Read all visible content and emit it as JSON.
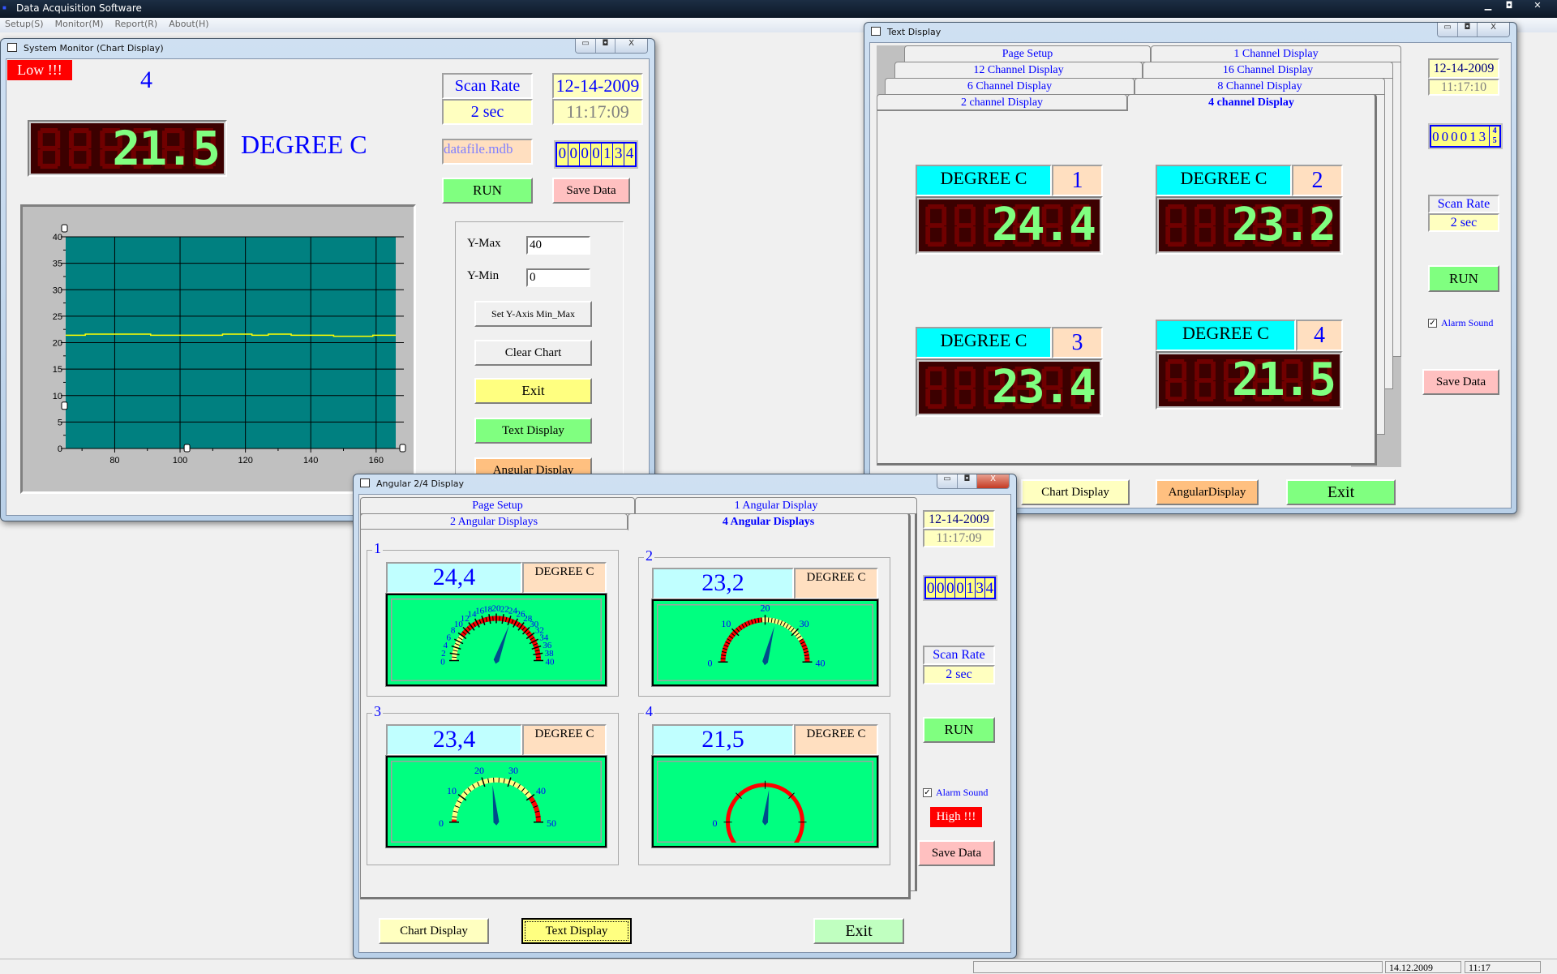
{
  "app": {
    "title": "Data Acquisition Software",
    "menu": [
      "Setup(S)",
      "Monitor(M)",
      "Report(R)",
      "About(H)"
    ]
  },
  "window_buttons": {
    "minimize": "▭",
    "maximize": "◘",
    "close": "X"
  },
  "chart_window": {
    "title": "System Monitor (Chart Display)",
    "alarm": "Low !!!",
    "channel": "4",
    "led_value": "21.5",
    "unit": "DEGREE C",
    "scan_rate_label": "Scan Rate",
    "scan_rate_value": "2 sec",
    "date": "12-14-2009",
    "time": "11:17:09",
    "file": "datafile.mdb",
    "counter": "0000134",
    "run": "RUN",
    "save": "Save Data",
    "ymax_label": "Y-Max",
    "ymax_value": "40",
    "ymin_label": "Y-Min",
    "ymin_value": "0",
    "set_axis": "Set Y-Axis Min_Max",
    "clear_chart": "Clear Chart",
    "exit": "Exit",
    "text_display": "Text Display",
    "angular_display": "Angular Display"
  },
  "chart_data": {
    "type": "line",
    "title": "",
    "xlabel": "",
    "ylabel": "",
    "xlim": [
      65,
      166
    ],
    "ylim": [
      0,
      40
    ],
    "xticks": [
      80,
      100,
      120,
      140,
      160
    ],
    "yticks": [
      0,
      5,
      10,
      15,
      20,
      25,
      30,
      35,
      40
    ],
    "grid": true,
    "background": "#008080",
    "series": [
      {
        "color": "#ffff00",
        "step": true,
        "x": [
          65,
          71,
          91,
          113,
          122,
          127,
          134,
          147,
          159,
          166
        ],
        "y": [
          21.4,
          21.6,
          21.4,
          21.6,
          21.4,
          21.6,
          21.4,
          21.2,
          21.4,
          21.4
        ]
      }
    ]
  },
  "text_window": {
    "title": "Text Display",
    "tabs": [
      [
        "Page Setup",
        "1 Channel Display"
      ],
      [
        "12 Channel Display",
        "16 Channel Display"
      ],
      [
        "6 Channel Display",
        "8 Channel Display"
      ],
      [
        "2 channel Display",
        "4 channel Display"
      ]
    ],
    "active_tab": "4 channel Display",
    "channels": [
      {
        "unit": "DEGREE C",
        "num": "1",
        "value": "24.4"
      },
      {
        "unit": "DEGREE C",
        "num": "2",
        "value": "23.2"
      },
      {
        "unit": "DEGREE C",
        "num": "3",
        "value": "23.4"
      },
      {
        "unit": "DEGREE C",
        "num": "4",
        "value": "21.5"
      }
    ],
    "date": "12-14-2009",
    "time": "11:17:10",
    "counter": "000013",
    "counter_rolling": [
      "4",
      "5"
    ],
    "scan_rate_label": "Scan Rate",
    "scan_rate_value": "2 sec",
    "run": "RUN",
    "alarm_sound": "Alarm Sound",
    "alarm_checked": true,
    "save": "Save Data",
    "chart_display": "Chart Display",
    "angular_display": "AngularDisplay",
    "exit": "Exit"
  },
  "angular_window": {
    "title": "Angular 2/4 Display",
    "tabs": [
      [
        "Page Setup",
        "1 Angular Display"
      ],
      [
        "2 Angular Displays",
        "4 Angular  Displays"
      ]
    ],
    "active_tab": "4 Angular  Displays",
    "gauges": [
      {
        "num": "1",
        "value": "24,4",
        "reading": 24.4,
        "unit": "DEGREE C",
        "max": 40,
        "labels": [
          0,
          2,
          4,
          6,
          8,
          10,
          12,
          14,
          16,
          18,
          20,
          22,
          24,
          26,
          28,
          30,
          32,
          34,
          36,
          38,
          40
        ],
        "zones": [
          {
            "from": 0,
            "to": 8,
            "color": "#ffff80"
          },
          {
            "from": 8,
            "to": 40,
            "color": "#ff0000"
          }
        ]
      },
      {
        "num": "2",
        "value": "23,2",
        "reading": 23.2,
        "unit": "DEGREE C",
        "max": 40,
        "labels": [
          0,
          10,
          20,
          30,
          40
        ],
        "zones": [
          {
            "from": 0,
            "to": 19,
            "color": "#ff0000"
          },
          {
            "from": 19,
            "to": 33,
            "color": "#ffff80"
          },
          {
            "from": 33,
            "to": 40,
            "color": "#ff0000"
          }
        ]
      },
      {
        "num": "3",
        "value": "23,4",
        "reading": 23.4,
        "unit": "DEGREE C",
        "max": 50,
        "labels": [
          0,
          10,
          20,
          30,
          40,
          50
        ],
        "zones": [
          {
            "from": 0,
            "to": 1,
            "color": "#ff0000"
          },
          {
            "from": 1,
            "to": 40,
            "color": "#ffff80"
          },
          {
            "from": 40,
            "to": 50,
            "color": "#ff0000"
          }
        ]
      },
      {
        "num": "4",
        "value": "21,5",
        "reading": 21.5,
        "unit": "DEGREE C",
        "max": 40,
        "labels": [
          0
        ],
        "full_circle": true,
        "zones": [
          {
            "from": 0,
            "to": 40,
            "color": "#ff0000"
          }
        ]
      }
    ],
    "date": "12-14-2009",
    "time": "11:17:09",
    "counter": "0000134",
    "scan_rate_label": "Scan Rate",
    "scan_rate_value": "2 sec",
    "run": "RUN",
    "alarm_sound": "Alarm Sound",
    "alarm_checked": true,
    "alarm": "High !!!",
    "save": "Save Data",
    "chart_display": "Chart Display",
    "text_display": "Text Display",
    "exit": "Exit"
  },
  "status_bar": {
    "date": "14.12.2009",
    "time": "11:17"
  },
  "colors": {
    "led_on": "#80ff80",
    "led_off": "#700000",
    "led_bg": "#3c0000",
    "alarm": "#ff0000",
    "gauge_face": "#00ff80",
    "needle": "#004c8c"
  }
}
